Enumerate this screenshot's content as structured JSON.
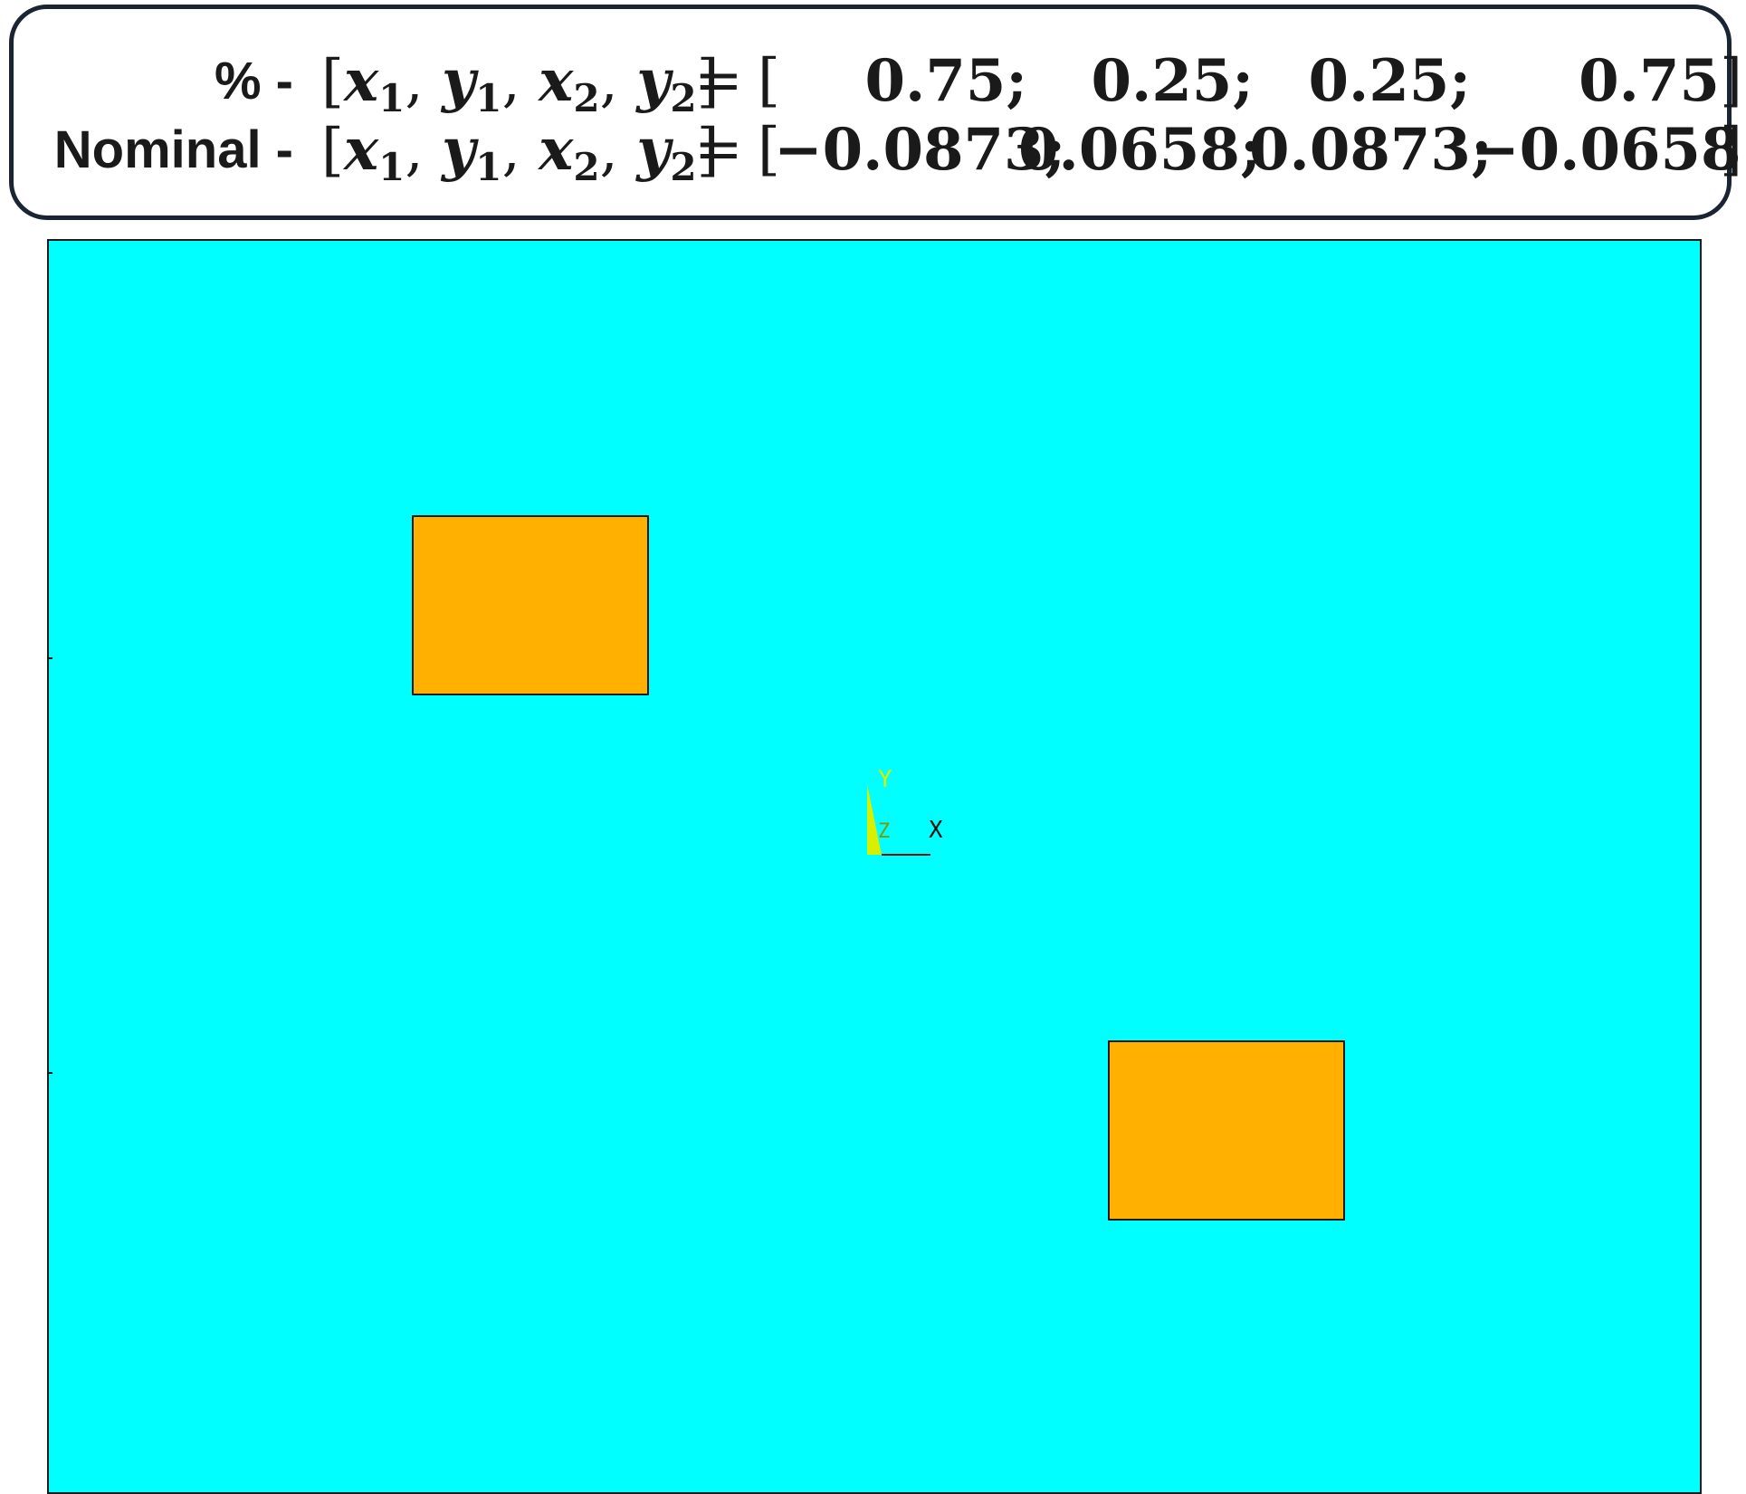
{
  "rows": [
    {
      "label": "% -",
      "vector": {
        "open": "[",
        "close": "]",
        "x1": "x",
        "y1": "y",
        "x2": "x",
        "y2": "y",
        "sub1": "1",
        "sub2": "2"
      },
      "equals": "=",
      "open_bracket": "[",
      "values": [
        "0.75;",
        "0.25;",
        "0.25;",
        "0.75"
      ],
      "close_bracket": "]"
    },
    {
      "label": "Nominal -",
      "vector": {
        "open": "[",
        "close": "]",
        "x1": "x",
        "y1": "y",
        "x2": "x",
        "y2": "y",
        "sub1": "1",
        "sub2": "2"
      },
      "equals": "=",
      "open_bracket": "[",
      "values": [
        "−0.0873;",
        "0.0658;",
        "0.0873;",
        "−0.0658"
      ],
      "close_bracket": "]"
    }
  ],
  "viewport": {
    "background_color": "#00ffff",
    "patch_color": "#ffb000",
    "patch_count": 2
  },
  "triad": {
    "y_label": "Y",
    "z_label": "Z",
    "x_label": "X"
  }
}
